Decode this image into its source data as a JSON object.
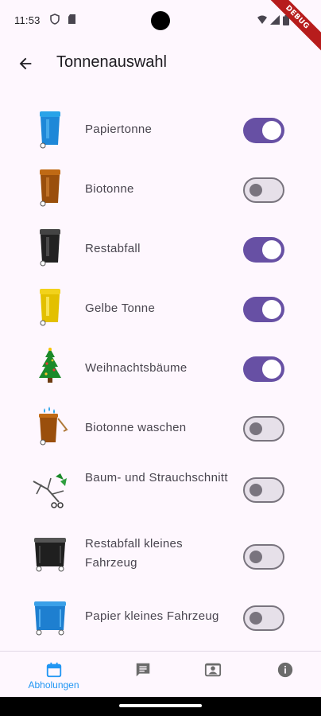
{
  "status_bar": {
    "time": "11:53"
  },
  "debug_banner": "DEBUG",
  "app_bar": {
    "title": "Tonnenauswahl",
    "back_icon": "arrow-back-icon"
  },
  "colors": {
    "accent": "#6750a4",
    "nav_active": "#2196f3",
    "background": "#fef7fe"
  },
  "bins": [
    {
      "label": "Papiertonne",
      "icon": "blue-bin-icon",
      "enabled": true
    },
    {
      "label": "Biotonne",
      "icon": "brown-bin-icon",
      "enabled": false
    },
    {
      "label": "Restabfall",
      "icon": "black-bin-icon",
      "enabled": true
    },
    {
      "label": "Gelbe Tonne",
      "icon": "yellow-bin-icon",
      "enabled": true
    },
    {
      "label": "Weihnachtsbäume",
      "icon": "christmas-tree-icon",
      "enabled": true
    },
    {
      "label": "Biotonne waschen",
      "icon": "bin-washing-icon",
      "enabled": false
    },
    {
      "label": "Baum- und Strauchschnitt",
      "icon": "branch-cutting-icon",
      "enabled": false
    },
    {
      "label": "Restabfall kleines Fahrzeug",
      "icon": "black-container-icon",
      "enabled": false
    },
    {
      "label": "Papier kleines Fahrzeug",
      "icon": "blue-container-icon",
      "enabled": false
    }
  ],
  "bottom_nav": {
    "items": [
      {
        "label": "Abholungen",
        "icon": "calendar-icon",
        "active": true
      },
      {
        "label": "",
        "icon": "message-icon",
        "active": false
      },
      {
        "label": "",
        "icon": "contact-card-icon",
        "active": false
      },
      {
        "label": "",
        "icon": "info-icon",
        "active": false
      }
    ]
  }
}
